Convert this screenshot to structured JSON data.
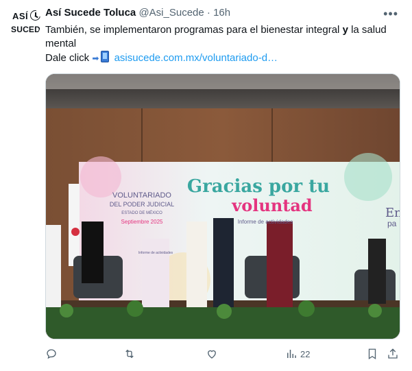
{
  "author": {
    "name": "Así Sucede Toluca",
    "handle": "@Asi_Sucede",
    "separator": "·",
    "time": "16h",
    "avatar_line1": "ASÍ",
    "avatar_line2": "SUCEDE"
  },
  "tweet": {
    "text_part1": "También, se implementaron programas para el bienestar integral ",
    "text_bold": "y",
    "text_part2": " la salud mental",
    "click_label": "Dale click",
    "link": "asisucede.com.mx/voluntariado-d…"
  },
  "media": {
    "banner_org_line1": "VOLUNTARIADO",
    "banner_org_line2": "DEL PODER JUDICIAL",
    "banner_org_line3": "ESTADO DE MÉXICO",
    "banner_date": "Septiembre 2025",
    "banner_title1": "Gracias por tu",
    "banner_title2": "voluntad",
    "banner_subtitle": "Informe de actividades",
    "banner_right": "En",
    "banner_right2": "pa",
    "podium_label": "Informe de actividades"
  },
  "actions": {
    "views_count": "22"
  },
  "colors": {
    "link": "#1d9bf0",
    "secondary_text": "#536471",
    "banner_teal": "#3aa7a0",
    "banner_pink": "#e4347f"
  }
}
